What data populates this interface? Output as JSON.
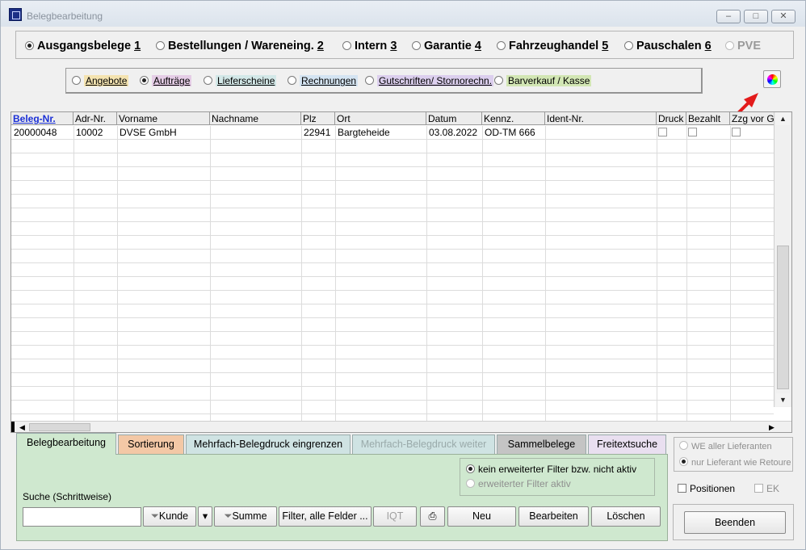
{
  "window": {
    "title": "Belegbearbeitung",
    "controls": [
      "–",
      "□",
      "✕"
    ]
  },
  "top_options": [
    {
      "label": "Ausgangsbelege",
      "hotkey": "1",
      "selected": true,
      "enabled": true
    },
    {
      "label": "Bestellungen / Wareneing.",
      "hotkey": "2",
      "selected": false,
      "enabled": true
    },
    {
      "label": "Intern",
      "hotkey": "3",
      "selected": false,
      "enabled": true
    },
    {
      "label": "Garantie",
      "hotkey": "4",
      "selected": false,
      "enabled": true
    },
    {
      "label": "Fahrzeughandel",
      "hotkey": "5",
      "selected": false,
      "enabled": true
    },
    {
      "label": "Pauschalen",
      "hotkey": "6",
      "selected": false,
      "enabled": true
    },
    {
      "label": "PVE",
      "hotkey": "",
      "selected": false,
      "enabled": false
    }
  ],
  "doc_types": [
    {
      "label": "Angebote",
      "selected": false,
      "color": "#f4e3b0"
    },
    {
      "label": "Aufträge",
      "selected": true,
      "color": "#e5cde6"
    },
    {
      "label": "Lieferscheine",
      "selected": false,
      "color": "#d3e8e8"
    },
    {
      "label": "Rechnungen",
      "selected": false,
      "color": "#d4e4f2"
    },
    {
      "label": "Gutschriften/ Stornorechn.",
      "selected": false,
      "color": "#dccfee"
    },
    {
      "label": "Barverkauf / Kasse",
      "selected": false,
      "color": "#d2e6b4"
    }
  ],
  "table": {
    "columns": [
      "Beleg-Nr.",
      "Adr-Nr.",
      "Vorname",
      "Nachname",
      "Plz",
      "Ort",
      "Datum",
      "Kennz.",
      "Ident-Nr.",
      "Druck",
      "Bezahlt",
      "Zzg vor GF"
    ],
    "rows": [
      {
        "beleg_nr": "20000048",
        "adr_nr": "10002",
        "vorname": "DVSE GmbH",
        "nachname": "",
        "plz": "22941",
        "ort": "Bargteheide",
        "datum": "03.08.2022",
        "kennz": "OD-TM 666",
        "ident_nr": "",
        "druck": false,
        "bezahlt": false,
        "zzg": false
      }
    ]
  },
  "tabs": [
    {
      "label": "Belegbearbeitung",
      "active": true,
      "color": "#cfe8cf",
      "enabled": true
    },
    {
      "label": "Sortierung",
      "active": false,
      "color": "#f3c8a6",
      "enabled": true
    },
    {
      "label": "Mehrfach-Belegdruck eingrenzen",
      "active": false,
      "color": "#cfe3e3",
      "enabled": true
    },
    {
      "label": "Mehrfach-Belegdruck weiter",
      "active": false,
      "color": "#cfe3e3",
      "enabled": false
    },
    {
      "label": "Sammelbelege",
      "active": false,
      "color": "#c4c4c4",
      "enabled": true
    },
    {
      "label": "Freitextsuche",
      "active": false,
      "color": "#e9dff0",
      "enabled": true
    }
  ],
  "filter": {
    "options": [
      {
        "label": "kein erweiterter Filter bzw. nicht aktiv",
        "selected": true,
        "enabled": true
      },
      {
        "label": "erweiterter Filter aktiv",
        "selected": false,
        "enabled": false
      }
    ]
  },
  "search": {
    "label": "Suche (Schrittweise)",
    "value": ""
  },
  "buttons": {
    "kunde": "Kunde",
    "dropdown": "▾",
    "summe": "Summe",
    "filter_all": "Filter, alle Felder ...",
    "iqt": "IQT",
    "print_icon": "printer-icon",
    "neu": "Neu",
    "bearbeiten": "Bearbeiten",
    "loeschen": "Löschen",
    "beenden": "Beenden"
  },
  "lieferant_options": [
    {
      "label": "WE aller Lieferanten",
      "selected": false
    },
    {
      "label": "nur Lieferant wie Retoure",
      "selected": true
    }
  ],
  "checkboxes": [
    {
      "label": "Positionen",
      "checked": false,
      "enabled": true
    },
    {
      "label": "EK",
      "checked": false,
      "enabled": false
    }
  ],
  "accent": {
    "arrow": "#e31b1b",
    "link": "#1a2fd6"
  }
}
